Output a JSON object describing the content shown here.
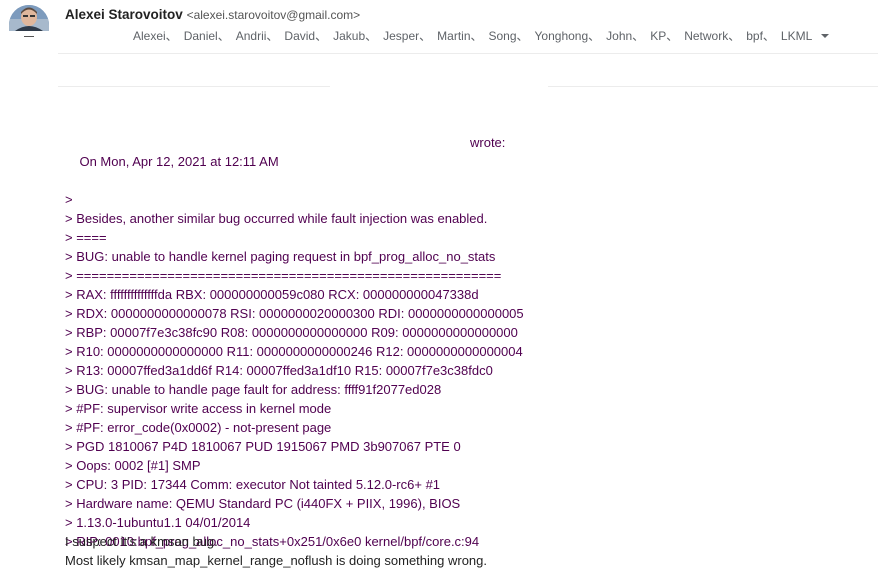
{
  "sender": {
    "name": "Alexei Starovoitov",
    "email": "<alexei.starovoitov@gmail.com>",
    "avatar_icon": "person-avatar-icon"
  },
  "recipients": [
    "Alexei、",
    "Daniel、",
    "Andrii、",
    "David、",
    "Jakub、",
    "Jesper、",
    "Martin、",
    "Song、",
    "Yonghong、",
    "John、",
    "KP、",
    "Network、",
    "bpf、",
    "LKML"
  ],
  "quote": {
    "attribution": "On Mon, Apr 12, 2021 at 12:11 AM",
    "wrote": "wrote:",
    "lines": [
      ">",
      "> Besides, another similar bug occurred while fault injection was enabled.",
      "> ====",
      "> BUG: unable to handle kernel paging request in bpf_prog_alloc_no_stats",
      "> ========================================================",
      "> RAX: ffffffffffffffda RBX: 000000000059c080 RCX: 000000000047338d",
      "> RDX: 0000000000000078 RSI: 0000000020000300 RDI: 0000000000000005",
      "> RBP: 00007f7e3c38fc90 R08: 0000000000000000 R09: 0000000000000000",
      "> R10: 0000000000000000 R11: 0000000000000246 R12: 0000000000000004",
      "> R13: 00007ffed3a1dd6f R14: 00007ffed3a1df10 R15: 00007f7e3c38fdc0",
      "> BUG: unable to handle page fault for address: ffff91f2077ed028",
      "> #PF: supervisor write access in kernel mode",
      "> #PF: error_code(0x0002) - not-present page",
      "> PGD 1810067 P4D 1810067 PUD 1915067 PMD 3b907067 PTE 0",
      "> Oops: 0002 [#1] SMP",
      "> CPU: 3 PID: 17344 Comm: executor Not tainted 5.12.0-rc6+ #1",
      "> Hardware name: QEMU Standard PC (i440FX + PIIX, 1996), BIOS",
      "> 1.13.0-1ubuntu1.1 04/01/2014",
      "> RIP: 0010:bpf_prog_alloc_no_stats+0x251/0x6e0 kernel/bpf/core.c:94"
    ]
  },
  "reply": {
    "lines": [
      "I suspect it's a kmsan bug.",
      "Most likely kmsan_map_kernel_range_noflush is doing something wrong."
    ]
  },
  "colors": {
    "quote_text": "#500050",
    "body_text": "#222222",
    "meta_text": "#5f6368"
  }
}
